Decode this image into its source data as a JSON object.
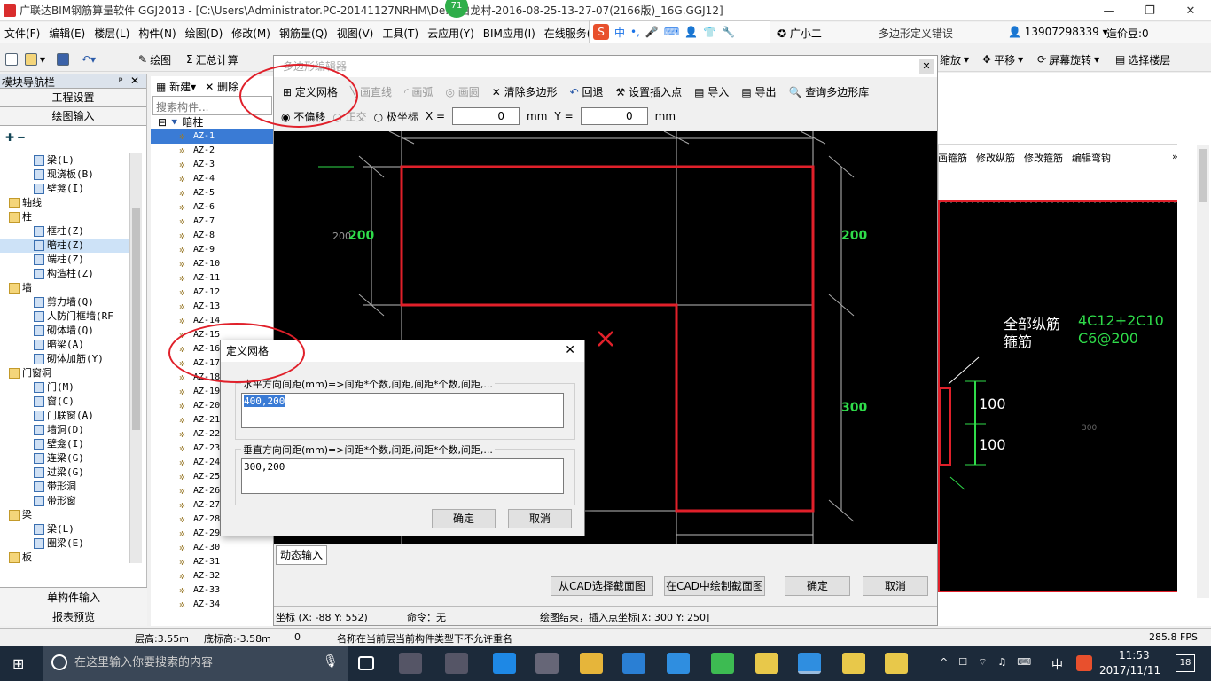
{
  "window": {
    "title": "广联达BIM钢筋算量软件 GGJ2013 - [C:\\Users\\Administrator.PC-20141127NRHM\\De...(白龙村-2016-08-25-13-27-07(2166版)_16G.GGJ12]",
    "badge": "71"
  },
  "menu": [
    "文件(F)",
    "编辑(E)",
    "楼层(L)",
    "构件(N)",
    "绘图(D)",
    "修改(M)",
    "钢筋量(Q)",
    "视图(V)",
    "工具(T)",
    "云应用(Y)",
    "BIM应用(I)",
    "在线服务(S)"
  ],
  "menu_right": {
    "assistant": "广小二",
    "error_msg": "多边形定义错误",
    "phone": "13907298339",
    "cost": "造价豆:0"
  },
  "toolbar": {
    "draw": "绘图",
    "sum": "汇总计算",
    "zoom": "缩放",
    "pan": "平移",
    "rotate": "屏幕旋转",
    "select_floor": "选择楼层"
  },
  "nav": {
    "title": "模块导航栏",
    "pin": "ᵖ",
    "close": "✕",
    "project_settings": "工程设置",
    "drawing_input": "绘图输入",
    "items": [
      "梁(L)",
      "现浇板(B)",
      "壁龛(I)",
      "轴线",
      "柱",
      "框柱(Z)",
      "暗柱(Z)",
      "端柱(Z)",
      "构造柱(Z)",
      "墙",
      "剪力墙(Q)",
      "人防门框墙(RF",
      "砌体墙(Q)",
      "暗梁(A)",
      "砌体加筋(Y)",
      "门窗洞",
      "门(M)",
      "窗(C)",
      "门联窗(A)",
      "墙洞(D)",
      "壁龛(I)",
      "连梁(G)",
      "过梁(G)",
      "带形洞",
      "带形窗",
      "梁",
      "梁(L)",
      "圈梁(E)",
      "板"
    ],
    "single_input": "单构件输入",
    "report": "报表预览"
  },
  "components": {
    "toolbar": {
      "new": "新建",
      "delete": "删除"
    },
    "search_placeholder": "搜索构件...",
    "root": "暗柱",
    "items": [
      "AZ-1",
      "AZ-2",
      "AZ-3",
      "AZ-4",
      "AZ-5",
      "AZ-6",
      "AZ-7",
      "AZ-8",
      "AZ-9",
      "AZ-10",
      "AZ-11",
      "AZ-12",
      "AZ-13",
      "AZ-14",
      "AZ-15",
      "AZ-16",
      "AZ-17",
      "AZ-18",
      "AZ-19",
      "AZ-20",
      "AZ-21",
      "AZ-22",
      "AZ-23",
      "AZ-24",
      "AZ-25",
      "AZ-26",
      "AZ-27",
      "AZ-28",
      "AZ-29",
      "AZ-30",
      "AZ-31",
      "AZ-32",
      "AZ-33",
      "AZ-34"
    ]
  },
  "editor": {
    "title": "多边形编辑器",
    "tools": {
      "grid": "定义网格",
      "line": "画直线",
      "arc": "画弧",
      "circle": "画圆",
      "clear": "清除多边形",
      "undo": "回退",
      "insert": "设置插入点",
      "import": "导入",
      "export": "导出",
      "query": "查询多边形库"
    },
    "offset": {
      "none": "不偏移",
      "ortho": "正交",
      "polar": "极坐标",
      "x_label": "X =",
      "x_value": "0",
      "y_label": "Y =",
      "y_value": "0",
      "unit": "mm"
    },
    "dims": {
      "top_left": "200",
      "left_200": "200",
      "right_200": "200",
      "right_300": "300"
    },
    "dynamic_input": "动态输入",
    "cad_select": "从CAD选择截面图",
    "cad_draw": "在CAD中绘制截面图",
    "ok": "确定",
    "cancel": "取消",
    "coords": "坐标 (X: -88 Y: 552)",
    "command": "命令：无",
    "status": "绘图结束，插入点坐标[X: 300 Y: 250]"
  },
  "grid_dialog": {
    "title": "定义网格",
    "h_label": "水平方向间距(mm)=>间距*个数,间距,间距*个数,间距,...",
    "h_value": "400,200",
    "v_label": "垂直方向间距(mm)=>间距*个数,间距,间距*个数,间距,...",
    "v_value": "300,200",
    "ok": "确定",
    "cancel": "取消"
  },
  "right_panel": {
    "tabs": [
      "画箍筋",
      "修改纵筋",
      "修改箍筋",
      "编辑弯钩"
    ],
    "text1": "全部纵筋",
    "text2": "箍筋",
    "value1": "4C12+2C10",
    "value2": "C6@200",
    "dim1": "100",
    "dim2": "100",
    "faint": "300"
  },
  "status_bar": {
    "floor_height": "层高:3.55m",
    "bottom_height": "底标高:-3.58m",
    "zero": "0",
    "msg": "名称在当前层当前构件类型下不允许重名",
    "fps": "285.8 FPS"
  },
  "taskbar": {
    "search": "在这里输入你要搜索的内容",
    "ime": "中",
    "time": "11:53",
    "date": "2017/11/11",
    "notif": "18"
  }
}
